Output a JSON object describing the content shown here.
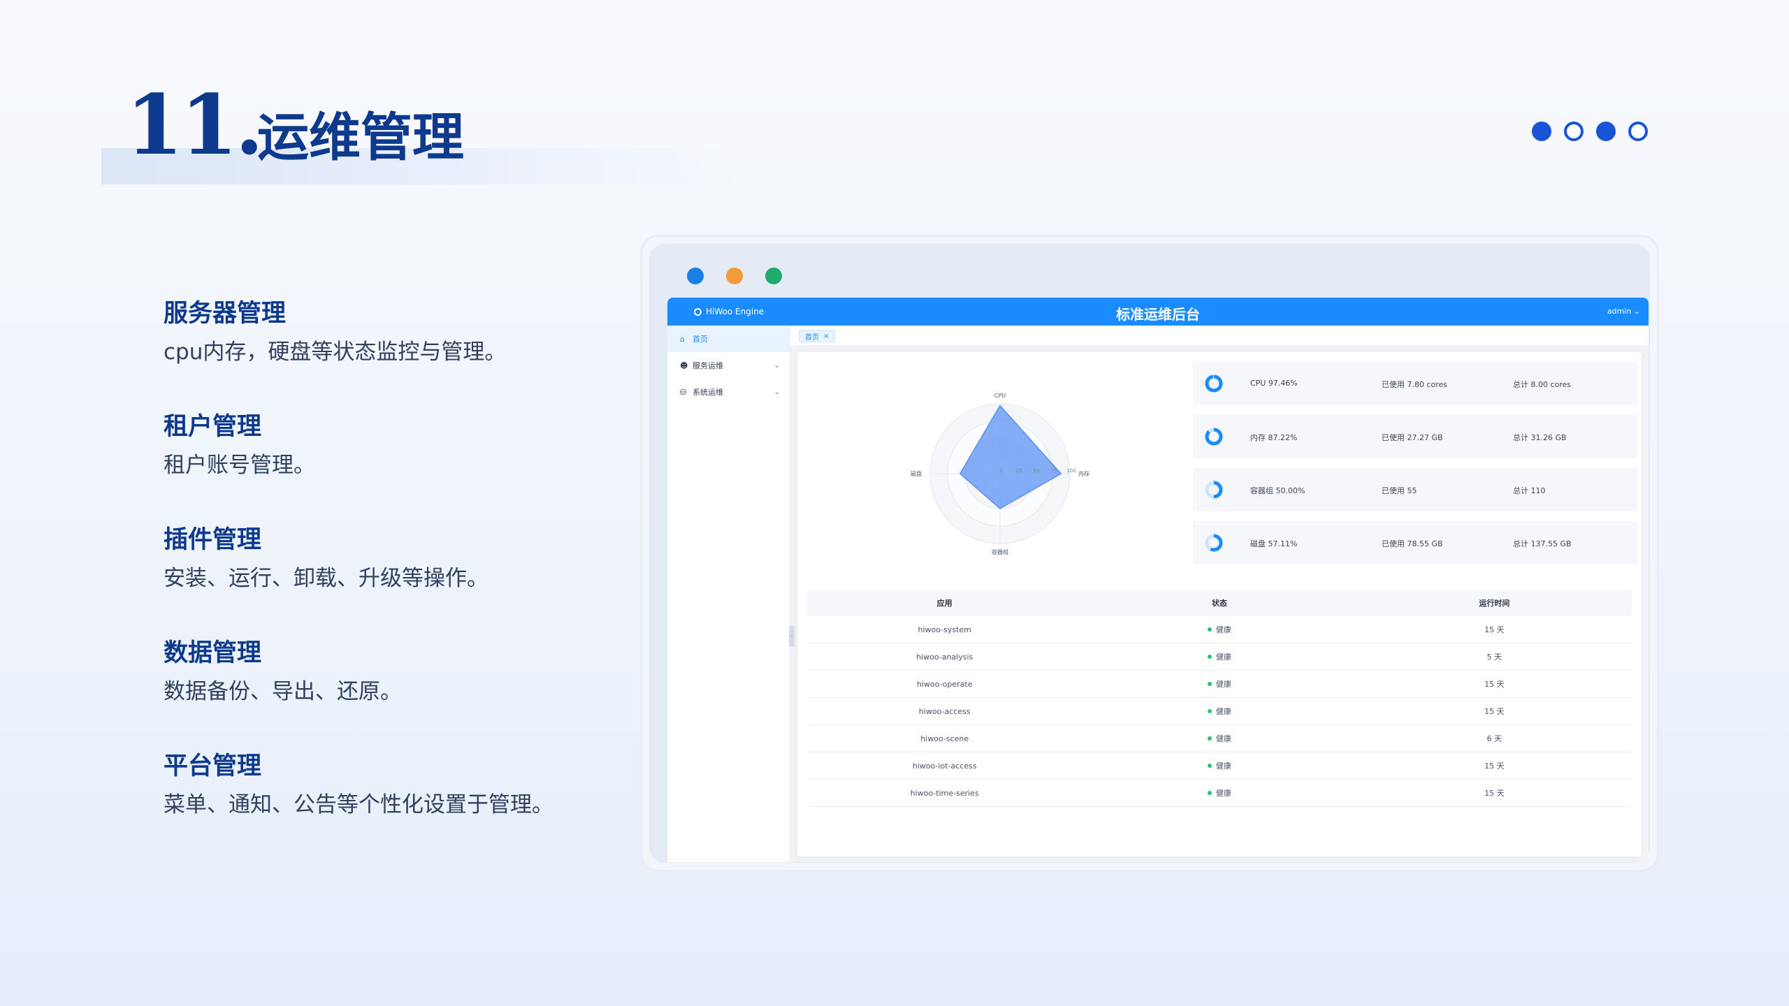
{
  "slide": {
    "number": "11.",
    "title": "运维管理",
    "pager": [
      "filled",
      "empty",
      "filled",
      "empty"
    ]
  },
  "features": [
    {
      "title": "服务器管理",
      "desc": "cpu内存，硬盘等状态监控与管理。"
    },
    {
      "title": "租户管理",
      "desc": "租户账号管理。"
    },
    {
      "title": "插件管理",
      "desc": "安装、运行、卸载、升级等操作。"
    },
    {
      "title": "数据管理",
      "desc": "数据备份、导出、还原。"
    },
    {
      "title": "平台管理",
      "desc": "菜单、通知、公告等个性化设置于管理。"
    }
  ],
  "colors": {
    "accent": "#1b8cff",
    "title": "#0d3a8c",
    "window_dots": [
      "#1b7fe8",
      "#f39a3b",
      "#1faa6e"
    ],
    "radar_fill": "#6e9ff5"
  },
  "app": {
    "brand": "HiWoo Engine",
    "title": "标准运维后台",
    "user": "admin",
    "user_chevron_icon": "chevron-down-icon",
    "menu": [
      {
        "label": "首页",
        "icon": "home-icon",
        "active": true
      },
      {
        "label": "服务运维",
        "icon": "user-icon",
        "active": false
      },
      {
        "label": "系统运维",
        "icon": "database-icon",
        "active": false
      }
    ],
    "tab": {
      "label": "首页",
      "close": "×"
    }
  },
  "chart_data": {
    "type": "radar",
    "indicators": [
      "CPU",
      "内存",
      "容器组",
      "磁盘"
    ],
    "values": [
      97.46,
      87.22,
      50.0,
      57.11
    ],
    "max": 100,
    "ticks": [
      "0",
      "25",
      "50",
      "75",
      "100"
    ]
  },
  "stats": [
    {
      "name": "CPU 97.46%",
      "used": "已使用 7.80 cores",
      "total": "总计 8.00 cores",
      "percent": 97.46
    },
    {
      "name": "内存 87.22%",
      "used": "已使用 27.27 GB",
      "total": "总计 31.26 GB",
      "percent": 87.22
    },
    {
      "name": "容器组 50.00%",
      "used": "已使用 55",
      "total": "总计 110",
      "percent": 50.0
    },
    {
      "name": "磁盘 57.11%",
      "used": "已使用 78.55 GB",
      "total": "总计 137.55 GB",
      "percent": 57.11
    }
  ],
  "table": {
    "headers": [
      "应用",
      "状态",
      "运行时间"
    ],
    "rows": [
      {
        "app": "hiwoo-system",
        "status": "健康",
        "uptime": "15 天"
      },
      {
        "app": "hiwoo-analysis",
        "status": "健康",
        "uptime": "5 天"
      },
      {
        "app": "hiwoo-operate",
        "status": "健康",
        "uptime": "15 天"
      },
      {
        "app": "hiwoo-access",
        "status": "健康",
        "uptime": "15 天"
      },
      {
        "app": "hiwoo-scene",
        "status": "健康",
        "uptime": "6 天"
      },
      {
        "app": "hiwoo-iot-access",
        "status": "健康",
        "uptime": "15 天"
      },
      {
        "app": "hiwoo-time-series",
        "status": "健康",
        "uptime": "15 天"
      }
    ]
  }
}
